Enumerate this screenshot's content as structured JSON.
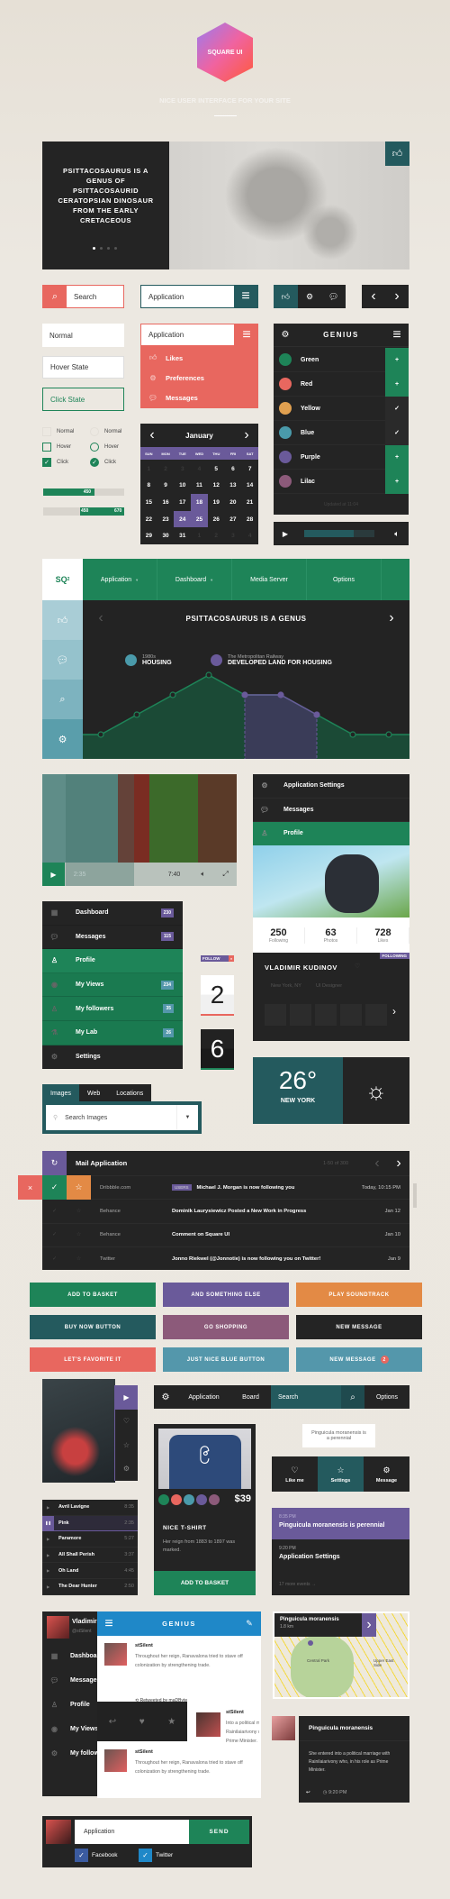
{
  "colors": {
    "background": "#ece8e1",
    "dark": "#242424",
    "green": "#1e8458",
    "teal": "#245a5e",
    "red": "#e8675f",
    "purple": "#6a5a9a",
    "orange": "#e38a45",
    "mauve": "#8c5a7a",
    "blue": "#5497ab",
    "facebook": "#3b5ba0",
    "twitter": "#1f88c8"
  },
  "header": {
    "logo_text": "SQUARE UI",
    "tagline": "NICE USER INTERFACE FOR YOUR SITE"
  },
  "hero": {
    "title": "PSITTACOSAURUS IS A GENUS OF PSITTACOSAURID CERATOPSIAN DINOSAUR FROM THE EARLY CRETACEOUS",
    "slides": 4,
    "active_slide": 1,
    "like_icon": "thumbs-up-icon"
  },
  "search": {
    "value": "Search",
    "icon": "search-icon"
  },
  "app_select": {
    "value": "Application",
    "icon": "hamburger-icon"
  },
  "icon_group": [
    "thumbs-up-icon",
    "gear-icon",
    "speech-bubble-icon"
  ],
  "pager": {
    "prev": "‹",
    "next": "›"
  },
  "inputs": {
    "normal": "Normal",
    "hover": "Hover State",
    "click": "Click State"
  },
  "dropdown": {
    "value": "Application",
    "items": [
      {
        "label": "Likes",
        "icon": "thumbs-up-icon"
      },
      {
        "label": "Preferences",
        "icon": "gear-icon"
      },
      {
        "label": "Messages",
        "icon": "speech-bubble-icon"
      }
    ]
  },
  "checks": {
    "checkbox": [
      {
        "label": "Normal",
        "state": "normal"
      },
      {
        "label": "Hover",
        "state": "hover"
      },
      {
        "label": "Click",
        "state": "checked"
      }
    ],
    "radio": [
      {
        "label": "Normal",
        "state": "normal"
      },
      {
        "label": "Hover",
        "state": "hover"
      },
      {
        "label": "Click",
        "state": "checked"
      }
    ]
  },
  "progress": {
    "single": {
      "value": "450",
      "percent": 63
    },
    "range": {
      "low": "450",
      "high": "670",
      "low_percent": 45,
      "high_percent": 100
    }
  },
  "calendar": {
    "month": "January",
    "weekdays": [
      "SUN",
      "MON",
      "TUE",
      "WED",
      "THU",
      "FRI",
      "SAT"
    ],
    "days": [
      [
        "1",
        0
      ],
      [
        "2",
        0
      ],
      [
        "3",
        0
      ],
      [
        "4",
        0
      ],
      [
        "5",
        1
      ],
      [
        "6",
        1
      ],
      [
        "7",
        1
      ],
      [
        "8",
        1
      ],
      [
        "9",
        1
      ],
      [
        "10",
        1
      ],
      [
        "11",
        1
      ],
      [
        "12",
        1
      ],
      [
        "13",
        1
      ],
      [
        "14",
        1
      ],
      [
        "15",
        1
      ],
      [
        "16",
        1
      ],
      [
        "17",
        1
      ],
      [
        "18",
        2
      ],
      [
        "19",
        1
      ],
      [
        "20",
        1
      ],
      [
        "21",
        1
      ],
      [
        "22",
        1
      ],
      [
        "23",
        1
      ],
      [
        "24",
        2
      ],
      [
        "25",
        2
      ],
      [
        "26",
        1
      ],
      [
        "27",
        1
      ],
      [
        "28",
        1
      ],
      [
        "29",
        1
      ],
      [
        "30",
        1
      ],
      [
        "31",
        1
      ],
      [
        "1",
        0
      ],
      [
        "2",
        0
      ],
      [
        "3",
        0
      ],
      [
        "4",
        0
      ]
    ]
  },
  "genius": {
    "title": "GENIUS",
    "footer": "Updated at 11:04",
    "items": [
      {
        "label": "Green",
        "color": "#1e8458",
        "state": "add"
      },
      {
        "label": "Red",
        "color": "#e8675f",
        "state": "add"
      },
      {
        "label": "Yellow",
        "color": "#e0a050",
        "state": "checked"
      },
      {
        "label": "Blue",
        "color": "#4a9aaa",
        "state": "checked"
      },
      {
        "label": "Purple",
        "color": "#6a5a9a",
        "state": "add"
      },
      {
        "label": "Lilac",
        "color": "#8c5a7a",
        "state": "add"
      }
    ]
  },
  "player": {
    "progress": 70
  },
  "dashboard": {
    "logo": "SQ",
    "logo_sup": "2",
    "nav": [
      "Application",
      "Dashboard",
      "Media Server",
      "Options"
    ],
    "sidebar_icons": [
      "thumbs-up-icon",
      "speech-bubble-icon",
      "search-icon",
      "gear-icon"
    ],
    "title": "PSITTACOSAURUS IS A GENUS",
    "legend": [
      {
        "sub": "1980s",
        "title": "HOUSING",
        "color": "#4a9aaa"
      },
      {
        "sub": "The Metropolitan Railway",
        "title": "DEVELOPED LAND FOR HOUSING",
        "color": "#6a5a9a"
      }
    ],
    "values": [
      0,
      1,
      2,
      3,
      2,
      2,
      1,
      0,
      0
    ],
    "highlight_range": [
      4,
      6
    ]
  },
  "video": {
    "current": "2:35",
    "total": "7:40",
    "progress": 40
  },
  "settings_menu": [
    {
      "label": "Application Settings",
      "icon": "gear-icon"
    },
    {
      "label": "Messages",
      "icon": "speech-bubble-icon"
    },
    {
      "label": "Profile",
      "icon": "user-icon",
      "active": true
    }
  ],
  "profile": {
    "stats": [
      {
        "value": "250",
        "label": "Following"
      },
      {
        "value": "63",
        "label": "Photos"
      },
      {
        "value": "728",
        "label": "Likes"
      }
    ],
    "badge": "FOLLOWING",
    "name": "VLADIMIR KUDINOV",
    "location": "New York, NY",
    "role": "UI Designer"
  },
  "left_menu": [
    {
      "label": "Dashboard",
      "badge": "230",
      "icon": "calendar-icon",
      "style": "dark",
      "badge_color": "#6a5a9a"
    },
    {
      "label": "Messages",
      "badge": "115",
      "icon": "speech-bubble-icon",
      "style": "dark",
      "badge_color": "#6a5a9a"
    },
    {
      "label": "Profile",
      "badge": "",
      "icon": "user-icon",
      "style": "active"
    },
    {
      "label": "My Views",
      "badge": "234",
      "icon": "eye-icon",
      "style": "green",
      "badge_color": "#5497ab"
    },
    {
      "label": "My followers",
      "badge": "35",
      "icon": "user-icon",
      "style": "green",
      "badge_color": "#5497ab"
    },
    {
      "label": "My Lab",
      "badge": "26",
      "icon": "flask-icon",
      "style": "green",
      "badge_color": "#5497ab"
    },
    {
      "label": "Settings",
      "badge": "",
      "icon": "gear-icon",
      "style": "dark"
    }
  ],
  "follow_badge": "FOLLOW",
  "counters": [
    "2",
    "6"
  ],
  "search_tabs": {
    "tabs": [
      "Images",
      "Web",
      "Locations"
    ],
    "active": 0,
    "placeholder": "Search Images"
  },
  "weather": {
    "temp": "26°",
    "city": "NEW YORK",
    "icon": "sun-icon"
  },
  "mail": {
    "title": "Mail Application",
    "range": "1-50 of 300",
    "swipe": [
      "close-icon",
      "check-icon",
      "star-icon"
    ],
    "rows": [
      {
        "from": "Dribbble.com",
        "tag": "USERS",
        "subject": "Michael J. Morgan is now following you",
        "date": "Today, 10:15 PM"
      },
      {
        "from": "Behance",
        "tag": "",
        "subject": "Dominik Laurysiewicz Posted a New Work in Progress",
        "date": "Jan 12"
      },
      {
        "from": "Behance",
        "tag": "",
        "subject": "Comment on Square UI",
        "date": "Jan 10"
      },
      {
        "from": "Twitter",
        "tag": "",
        "subject": "Jonno Riekwel (@Jonnotie) is now following you on Twitter!",
        "date": "Jan 9"
      }
    ]
  },
  "buttons": [
    {
      "label": "ADD TO BASKET",
      "color": "#1e8458"
    },
    {
      "label": "AND SOMETHING ELSE",
      "color": "#6a5a9a"
    },
    {
      "label": "PLAY SOUNDTRACK",
      "color": "#e38a45"
    },
    {
      "label": "BUY NOW BUTTON",
      "color": "#245a5e"
    },
    {
      "label": "GO SHOPPING",
      "color": "#8c5a7a"
    },
    {
      "label": "NEW MESSAGE",
      "color": "#242424"
    },
    {
      "label": "LET'S FAVORITE IT",
      "color": "#e8675f"
    },
    {
      "label": "JUST NICE BLUE BUTTON",
      "color": "#5497ab"
    },
    {
      "label": "NEW MESSAGE",
      "color": "#5497ab",
      "count": "2"
    }
  ],
  "album_icons": [
    "play-icon",
    "heart-icon",
    "star-icon",
    "gear-icon"
  ],
  "playlist": [
    {
      "artist": "Avril Lavigne",
      "time": "8:35"
    },
    {
      "artist": "Pink",
      "time": "2:35",
      "playing": true
    },
    {
      "artist": "Paramore",
      "time": "5:27"
    },
    {
      "artist": "All Shall Perish",
      "time": "3:37"
    },
    {
      "artist": "Oh Land",
      "time": "4:45"
    },
    {
      "artist": "The Dear Hunter",
      "time": "2:50"
    }
  ],
  "nav2": {
    "items": [
      "Application",
      "Board"
    ],
    "search": "Search",
    "options": "Options"
  },
  "tshirt": {
    "price": "$39",
    "title": "NICE T-SHIRT",
    "desc": "Her reign from 1883 to 1897 was marked.",
    "button": "ADD TO BASKET",
    "swatches": [
      "#1e8458",
      "#e8675f",
      "#4a9aaa",
      "#6a5a9a",
      "#8c5a7a"
    ]
  },
  "tooltip": "Pinguicula moranensis is a perennial",
  "tabbar": [
    {
      "label": "Like me",
      "icon": "heart-icon"
    },
    {
      "label": "Settings",
      "icon": "star-icon",
      "active": true
    },
    {
      "label": "Message",
      "icon": "gear-icon"
    }
  ],
  "events": {
    "items": [
      {
        "time": "8:35 PM",
        "title": "Pinguicula moranensis is perennial"
      },
      {
        "time": "9:20 PM",
        "title": "Application Settings"
      }
    ],
    "more": "17 more events"
  },
  "social": {
    "name": "Vladimir",
    "handle": "@stSilent",
    "menu": [
      "Dashboard",
      "Messages",
      "Profile",
      "My Views",
      "My followers"
    ]
  },
  "feed": {
    "title": "GENIUS",
    "posts": [
      {
        "user": "stSilent",
        "text": "Throughout her reign, Ranavalona tried to stave off colonization by strengthening trade."
      },
      {
        "user": "stSilent",
        "text": "Into a political marriage with Rainilaiarivony who, in his role as Prime Minister."
      },
      {
        "user": "stSilent",
        "text": "Throughout her reign, Ranavalona tried to stave off colonization by strengthening trade."
      }
    ],
    "retweet": "Retweeted by maDByte"
  },
  "map": {
    "place": "Pinguicula moranensis",
    "distance": "1.8 km",
    "labels": [
      "Central Park",
      "Upper East Side"
    ]
  },
  "comment": {
    "title": "Pinguicula moranensis",
    "text": "She entered into a political marriage with Rainilaiarivony who, in his role as Prime Minister.",
    "time": "9:20 PM"
  },
  "composer": {
    "value": "Application",
    "send": "SEND",
    "options": [
      {
        "label": "Facebook",
        "checked": true
      },
      {
        "label": "Twitter",
        "checked": true
      }
    ]
  }
}
